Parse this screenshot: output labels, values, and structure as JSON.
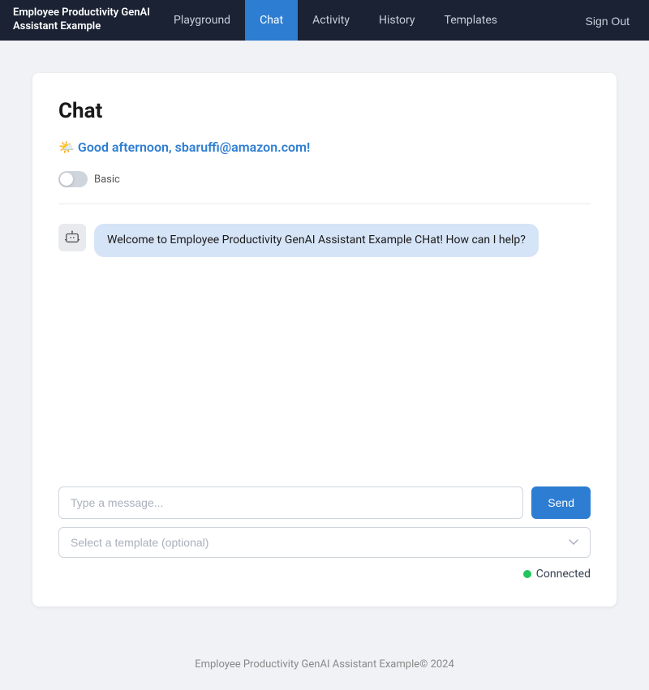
{
  "navbar": {
    "brand": "Employee Productivity GenAI Assistant Example",
    "nav_items": [
      {
        "label": "Playground",
        "active": false
      },
      {
        "label": "Chat",
        "active": true
      },
      {
        "label": "Activity",
        "active": false
      },
      {
        "label": "History",
        "active": false
      },
      {
        "label": "Templates",
        "active": false
      }
    ],
    "signout_label": "Sign Out"
  },
  "chat": {
    "page_title": "Chat",
    "greeting_emoji": "🌤️",
    "greeting_text": "Good afternoon, sbaruffi@amazon.com!",
    "toggle_label": "Basic",
    "welcome_message": "Welcome to Employee Productivity GenAI Assistant Example CHat! How can I help?",
    "message_input_placeholder": "Type a message...",
    "send_button_label": "Send",
    "template_select_placeholder": "Select a template (optional)",
    "status_label": "Connected"
  },
  "footer": {
    "text": "Employee Productivity GenAI Assistant Example© 2024"
  }
}
